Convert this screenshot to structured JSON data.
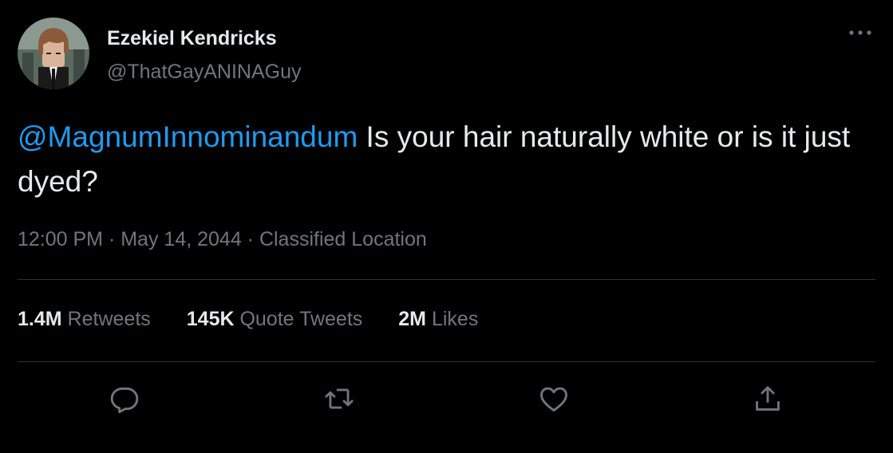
{
  "author": {
    "display_name": "Ezekiel Kendricks",
    "handle": "@ThatGayANINAGuy",
    "avatar_icon": "avatar-image"
  },
  "tweet": {
    "mention": "@MagnumInnominandum",
    "text": " Is your hair naturally white or is it just dyed?"
  },
  "meta": {
    "time": "12:00 PM",
    "sep1": " · ",
    "date": "May 14, 2044",
    "sep2": " · ",
    "location": "Classified Location"
  },
  "stats": [
    {
      "count": "1.4M",
      "label": "Retweets"
    },
    {
      "count": "145K",
      "label": "Quote Tweets"
    },
    {
      "count": "2M",
      "label": "Likes"
    }
  ],
  "actions": {
    "reply_icon": "reply-icon",
    "retweet_icon": "retweet-icon",
    "like_icon": "like-icon",
    "share_icon": "share-icon",
    "more_icon": "more-icon"
  },
  "colors": {
    "background": "#000000",
    "text": "#e7e9ea",
    "secondary": "#71767b",
    "accent": "#1d9bf0",
    "divider": "#2f3336"
  }
}
